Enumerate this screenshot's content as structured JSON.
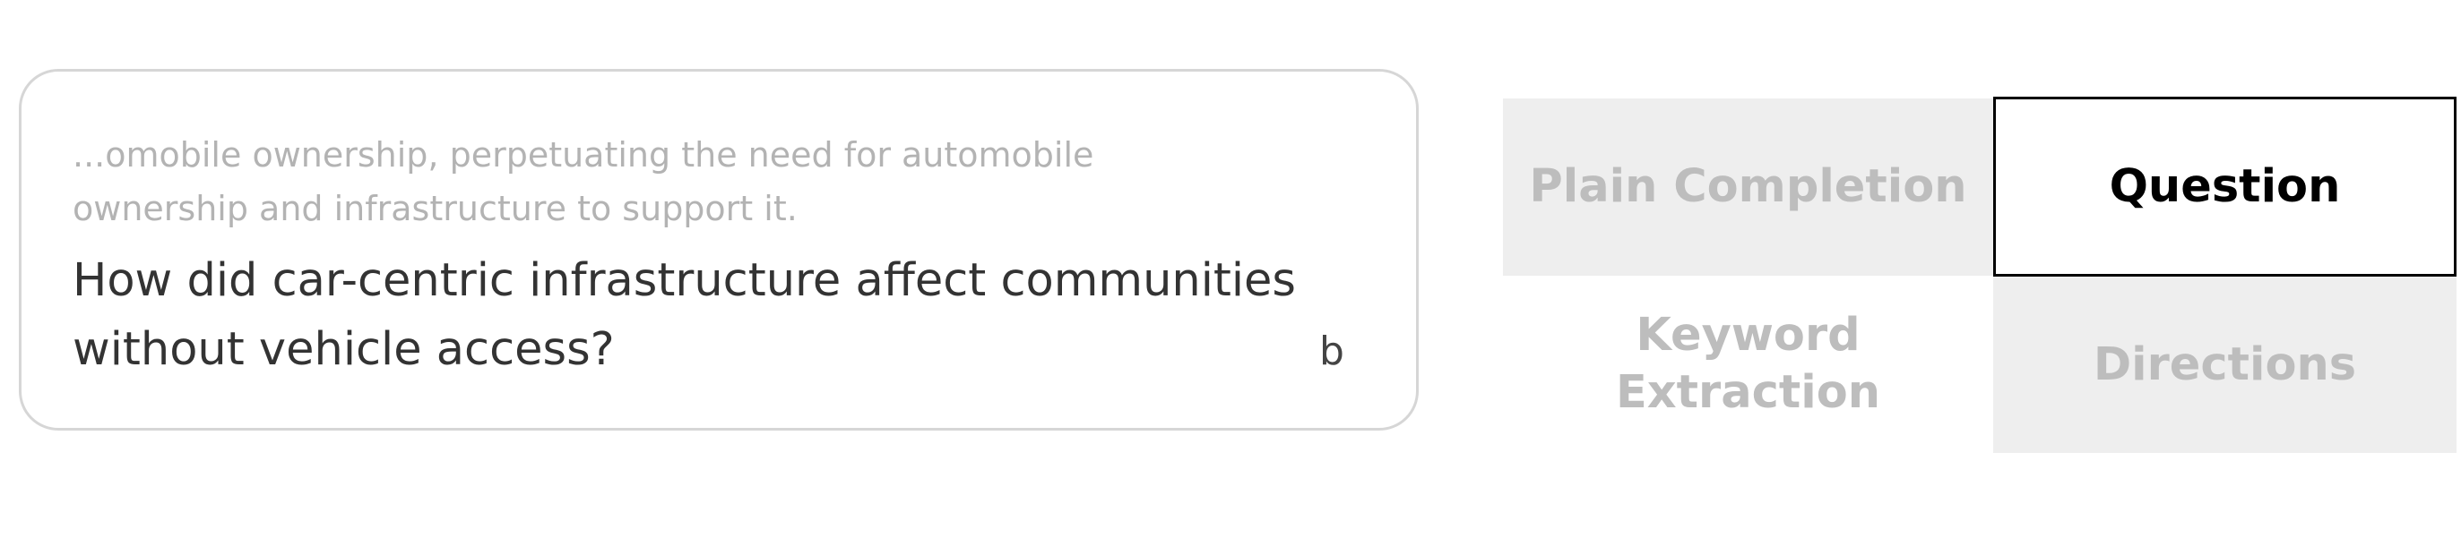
{
  "prompt": {
    "context": "...omobile ownership, perpetuating the need for automobile ownership and infrastructure to support it.",
    "question": "How did car-centric infrastructure affect communities without vehicle access?",
    "corner_letter": "b"
  },
  "modes": {
    "plain_completion": "Plain Completion",
    "question": "Question",
    "keyword_extraction": "Keyword Extraction",
    "directions": "Directions",
    "selected": "Question"
  },
  "colors": {
    "card_border": "#d6d6d6",
    "context_text": "#b3b3b3",
    "question_text": "#333333",
    "option_bg": "#eeeeee",
    "option_text": "#bdbdbd",
    "selected_border": "#000000",
    "selected_text": "#000000"
  }
}
